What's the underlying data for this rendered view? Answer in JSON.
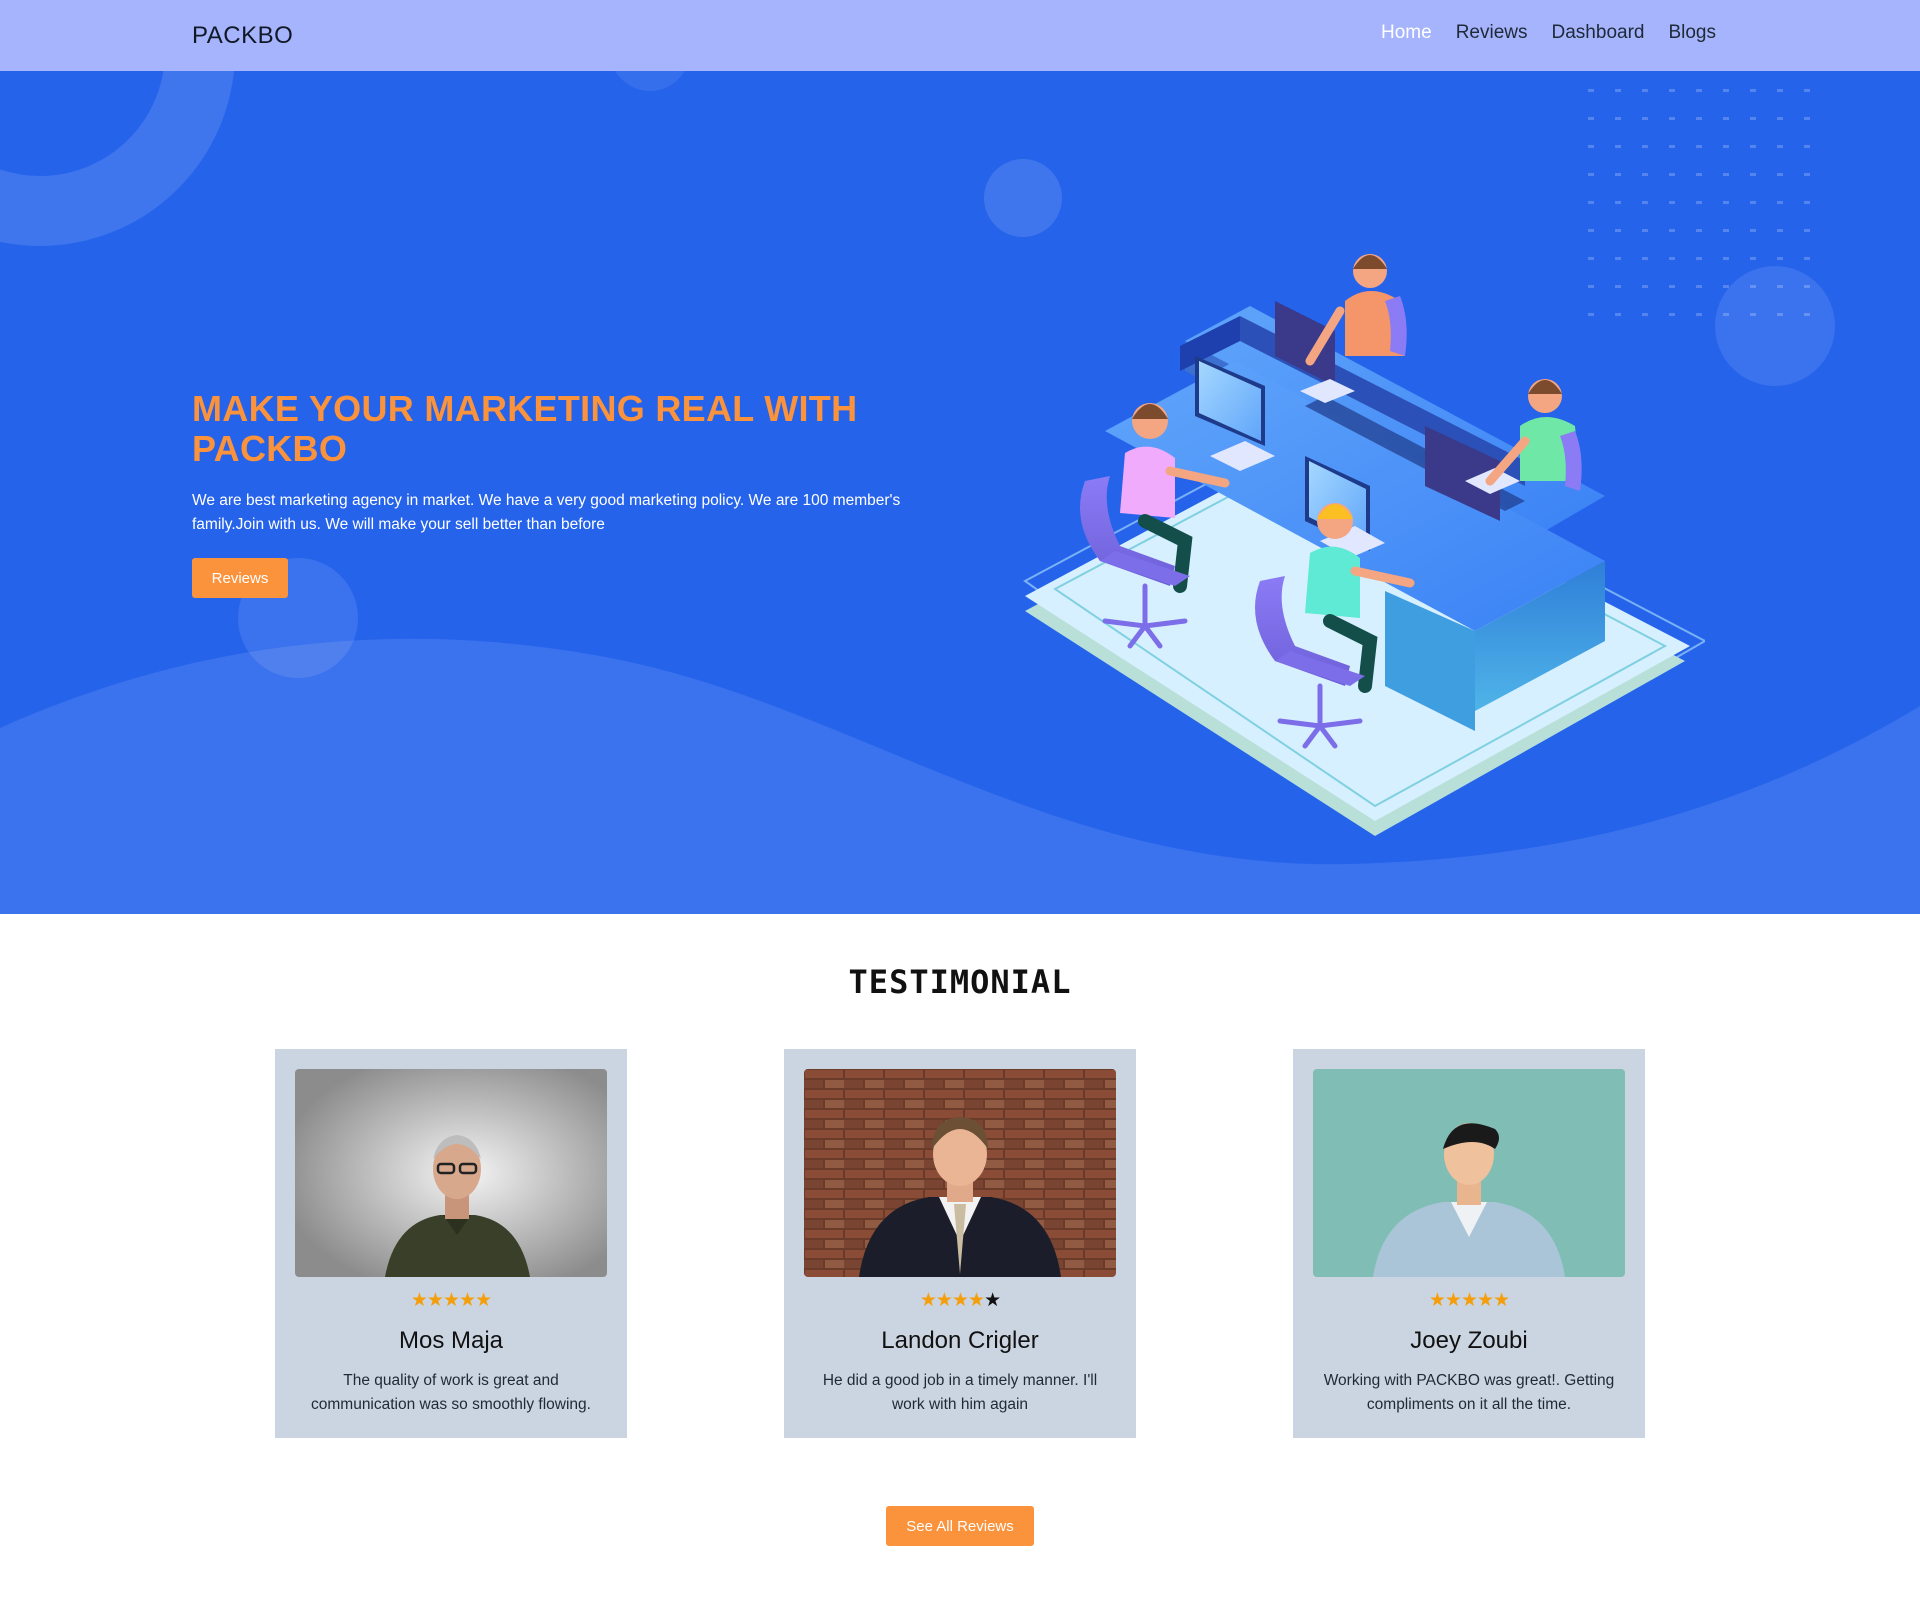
{
  "nav": {
    "brand": "PACKBO",
    "links": [
      "Home",
      "Reviews",
      "Dashboard",
      "Blogs"
    ],
    "active": "Home"
  },
  "hero": {
    "title": "MAKE YOUR MARKETING REAL WITH PACKBO",
    "text": "We are best marketing agency in market. We have a very good marketing policy. We are 100 member's family.Join with us. We will make your sell better than before",
    "button": "Reviews"
  },
  "testimonial": {
    "title": "TESTIMONIAL",
    "reviews": [
      {
        "name": "Mos Maja",
        "rating": 5,
        "quote": "The quality of work is great and communication was so smoothly flowing."
      },
      {
        "name": "Landon Crigler",
        "rating": 3.5,
        "quote": "He did a good job in a timely manner. I'll work with him again"
      },
      {
        "name": "Joey Zoubi",
        "rating": 4.5,
        "quote": "Working with PACKBO was great!. Getting compliments on it all the time."
      }
    ],
    "see_all": "See All Reviews"
  },
  "colors": {
    "nav_bg": "#a5b4fc",
    "hero_bg": "#2563eb",
    "accent": "#fb923c",
    "card_bg": "#cbd5e1",
    "star": "#f59e0b"
  }
}
